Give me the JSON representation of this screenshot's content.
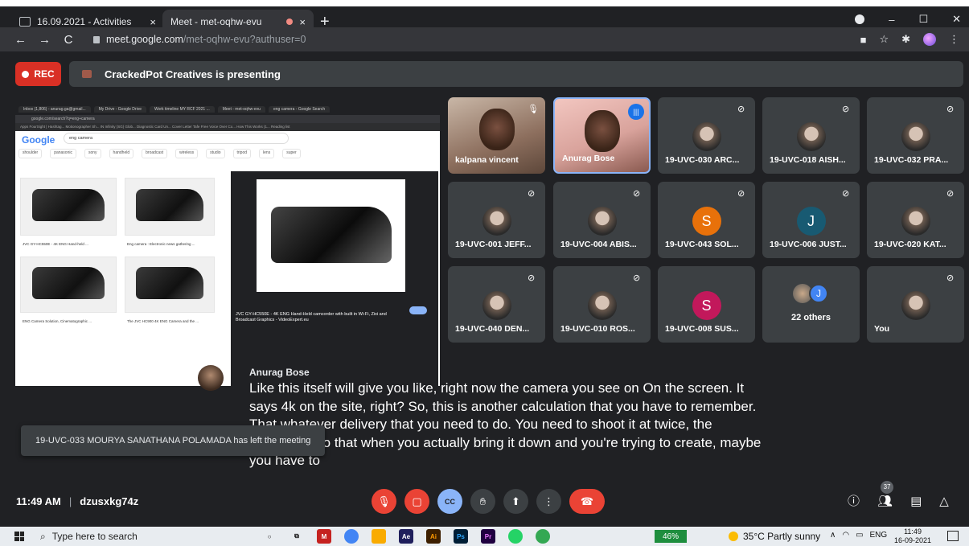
{
  "browser": {
    "tabs": [
      {
        "title": "16.09.2021 - Activities",
        "close": "×"
      },
      {
        "title": "Meet - met-oqhw-evu",
        "close": "×"
      }
    ],
    "new_tab": "+",
    "window_controls": {
      "minimize": "–",
      "maximize": "☐",
      "close": "✕"
    },
    "nav": {
      "back": "←",
      "forward": "→",
      "reload": "C"
    },
    "url_host": "meet.google.com",
    "url_path": "/met-oqhw-evu?authuser=0"
  },
  "meet": {
    "rec_label": "REC",
    "presenting_text": "CrackedPot Creatives is presenting",
    "shared_screen": {
      "tabs": [
        "Inbox (1,806) - anurag.ga@gmail...",
        "My Drive - Google Drive",
        "Work timeline MY RCF 2021 ...",
        "Meet - met-oqhw-evu",
        "eng camera - Google Search"
      ],
      "bookmarks": "Apps  FourSight | Hashtag...  Motionographer Sh...  IN Infinity (SG) Glob...  Diagnostic Card Un...  Cover Letter Tafe  Free Voice Over Co...  How This Works (1...  Reading list",
      "logo": "Google",
      "query": "eng camera",
      "chips": [
        "shoulder",
        "panasonic",
        "sony",
        "handheld",
        "broadcast",
        "wireless",
        "studio",
        "tripod",
        "lens",
        "super"
      ],
      "captions": [
        "JVC GY-HC550E - 4K ENG Hand-held ...",
        "Eng camera : Electronic news gathering ...",
        "ENG Camera Solution, Cinematographic ...",
        "The JVC HC900 4K ENG Camera and the ..."
      ],
      "preview_title": "JVC GY-HC550E - 4K ENG Hand-Held camcorder with built in Wi-Fi, Zixi and Broadcast Graphics - VideoExpert.eu"
    },
    "participants": [
      {
        "name": "kalpana vincent"
      },
      {
        "name": "Anurag Bose"
      },
      {
        "name": "19-UVC-030 ARC..."
      },
      {
        "name": "19-UVC-018 AISH..."
      },
      {
        "name": "19-UVC-032 PRA..."
      },
      {
        "name": "19-UVC-001 JEFF..."
      },
      {
        "name": "19-UVC-004 ABIS..."
      },
      {
        "name": "19-UVC-043 SOL...",
        "initial": "S"
      },
      {
        "name": "19-UVC-006 JUST...",
        "initial": "J"
      },
      {
        "name": "19-UVC-020 KAT..."
      },
      {
        "name": "19-UVC-040 DEN..."
      },
      {
        "name": "19-UVC-010 ROS..."
      },
      {
        "name": "19-UVC-008 SUS...",
        "initial": "S"
      },
      {
        "name": "22 others",
        "initial": "J"
      },
      {
        "name": "You"
      }
    ],
    "caption": {
      "speaker": "Anurag Bose",
      "text": "Like this itself will give you like, right now the camera you see on On the screen. It says 4k on the site, right? So, this is another calculation that you have to remember. That whatever delivery that you need to do. You need to shoot it at twice, the resolution. so that when you actually bring it down and you're trying to create, maybe you have to"
    },
    "toast": "19-UVC-033 MOURYA SANATHANA POLAMADA has left the meeting",
    "time": "11:49 AM",
    "meeting_code": "dzusxkg74z",
    "people_count": "37",
    "controls": {
      "cc": "CC"
    }
  },
  "taskbar": {
    "search_placeholder": "Type here to search",
    "battery": "46%",
    "weather": "35°C  Partly sunny",
    "lang": "ENG",
    "time": "11:49",
    "date": "16-09-2021",
    "apps": [
      {
        "label": "M",
        "color": "#c5221f"
      },
      {
        "label": "",
        "color": "#4285f4"
      },
      {
        "label": "",
        "color": "#f9ab00"
      },
      {
        "label": "Ae",
        "color": "#1f1f5c"
      },
      {
        "label": "Ai",
        "color": "#3d1f00"
      },
      {
        "label": "Ps",
        "color": "#001e36"
      },
      {
        "label": "Pr",
        "color": "#1f0040"
      },
      {
        "label": "",
        "color": "#25d366"
      },
      {
        "label": "",
        "color": "#34a853"
      }
    ]
  },
  "colors": {
    "accent": "#8ab4f8",
    "danger": "#ea4335",
    "surface": "#3c4043",
    "background": "#202124"
  }
}
